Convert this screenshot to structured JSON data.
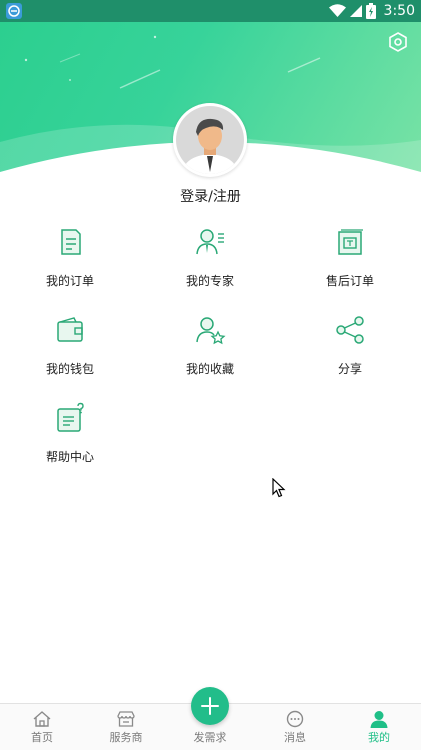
{
  "status_bar": {
    "time": "3:50"
  },
  "profile": {
    "login_label": "登录/注册"
  },
  "menu": [
    {
      "label": "我的订单",
      "icon": "order-icon"
    },
    {
      "label": "我的专家",
      "icon": "expert-icon"
    },
    {
      "label": "售后订单",
      "icon": "after-sale-icon"
    },
    {
      "label": "我的钱包",
      "icon": "wallet-icon"
    },
    {
      "label": "我的收藏",
      "icon": "favorite-icon"
    },
    {
      "label": "分享",
      "icon": "share-icon"
    },
    {
      "label": "帮助中心",
      "icon": "help-icon"
    }
  ],
  "bottom_nav": {
    "items": [
      {
        "label": "首页",
        "icon": "home-icon"
      },
      {
        "label": "服务商",
        "icon": "shop-icon"
      },
      {
        "label": "发需求",
        "icon": "plus-icon"
      },
      {
        "label": "消息",
        "icon": "message-icon"
      },
      {
        "label": "我的",
        "icon": "user-icon",
        "active": true
      }
    ]
  },
  "colors": {
    "accent": "#22bd8a",
    "status_bar": "#1f8f6a",
    "icon_green": "#2aa876"
  }
}
